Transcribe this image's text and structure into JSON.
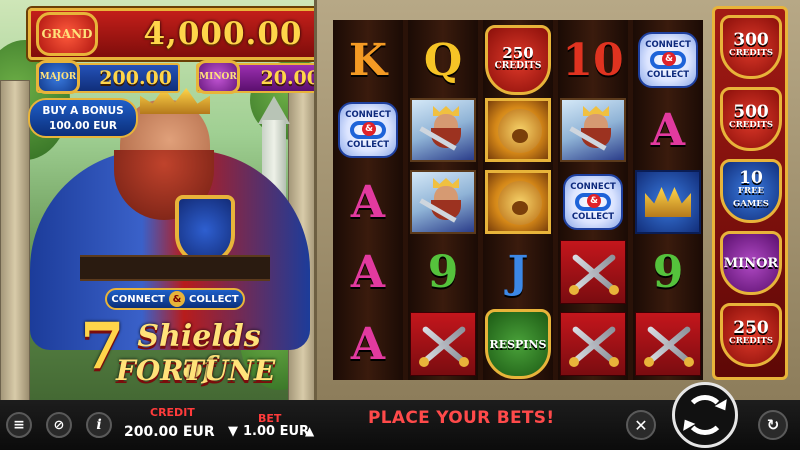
{
  "jackpots": {
    "grand": {
      "label": "GRAND",
      "value": "4,000.00"
    },
    "major": {
      "label": "MAJOR",
      "value": "200.00"
    },
    "minor": {
      "label": "MINOR",
      "value": "20.00"
    }
  },
  "buy_bonus": {
    "line1": "BUY A BONUS",
    "line2": "100.00 EUR"
  },
  "logo": {
    "connect_collect": {
      "left": "CONNECT",
      "amp": "&",
      "right": "COLLECT"
    },
    "title_number": "7",
    "title_line1": "Shields of",
    "title_line2": "FORTUNE"
  },
  "reels": {
    "col1": [
      {
        "type": "letter",
        "text": "K",
        "color": "orange"
      },
      {
        "type": "cc",
        "line1": "CONNECT",
        "line2": "COLLECT"
      },
      {
        "type": "letter",
        "text": "A",
        "color": "magenta"
      },
      {
        "type": "letter",
        "text": "A",
        "color": "magenta"
      },
      {
        "type": "letter",
        "text": "A",
        "color": "magenta"
      }
    ],
    "col2": [
      {
        "type": "letter",
        "text": "Q",
        "color": "gold"
      },
      {
        "type": "king"
      },
      {
        "type": "king"
      },
      {
        "type": "letter",
        "text": "9",
        "color": "green"
      },
      {
        "type": "swords"
      }
    ],
    "col3": [
      {
        "type": "shield",
        "style": "red",
        "line1": "250",
        "line2": "CREDITS"
      },
      {
        "type": "lion"
      },
      {
        "type": "lion"
      },
      {
        "type": "letter",
        "text": "J",
        "color": "blue"
      },
      {
        "type": "shield",
        "style": "green",
        "line1": "RESPINS",
        "line2": ""
      }
    ],
    "col4": [
      {
        "type": "letter",
        "text": "10",
        "color": "red"
      },
      {
        "type": "king"
      },
      {
        "type": "cc",
        "line1": "CONNECT",
        "line2": "COLLECT"
      },
      {
        "type": "swords"
      },
      {
        "type": "swords"
      }
    ],
    "col5": [
      {
        "type": "cc",
        "line1": "CONNECT",
        "line2": "COLLECT"
      },
      {
        "type": "letter",
        "text": "A",
        "color": "magenta"
      },
      {
        "type": "crown"
      },
      {
        "type": "letter",
        "text": "9",
        "color": "green"
      },
      {
        "type": "swords"
      }
    ]
  },
  "side_reel": [
    {
      "style": "red",
      "line1": "300",
      "line2": "CREDITS"
    },
    {
      "style": "red",
      "line1": "500",
      "line2": "CREDITS"
    },
    {
      "style": "blue",
      "line1": "10",
      "line2": "FREE GAMES"
    },
    {
      "style": "purple",
      "line1": "MINOR",
      "line2": ""
    },
    {
      "style": "red",
      "line1": "250",
      "line2": "CREDITS"
    }
  ],
  "bottom_bar": {
    "credit_label": "CREDIT",
    "credit_value": "200.00 EUR",
    "bet_label": "BET",
    "bet_value": "1.00 EUR",
    "bet_down": "▼",
    "bet_up": "▲",
    "message": "PLACE YOUR BETS!",
    "info_glyph": "i"
  }
}
